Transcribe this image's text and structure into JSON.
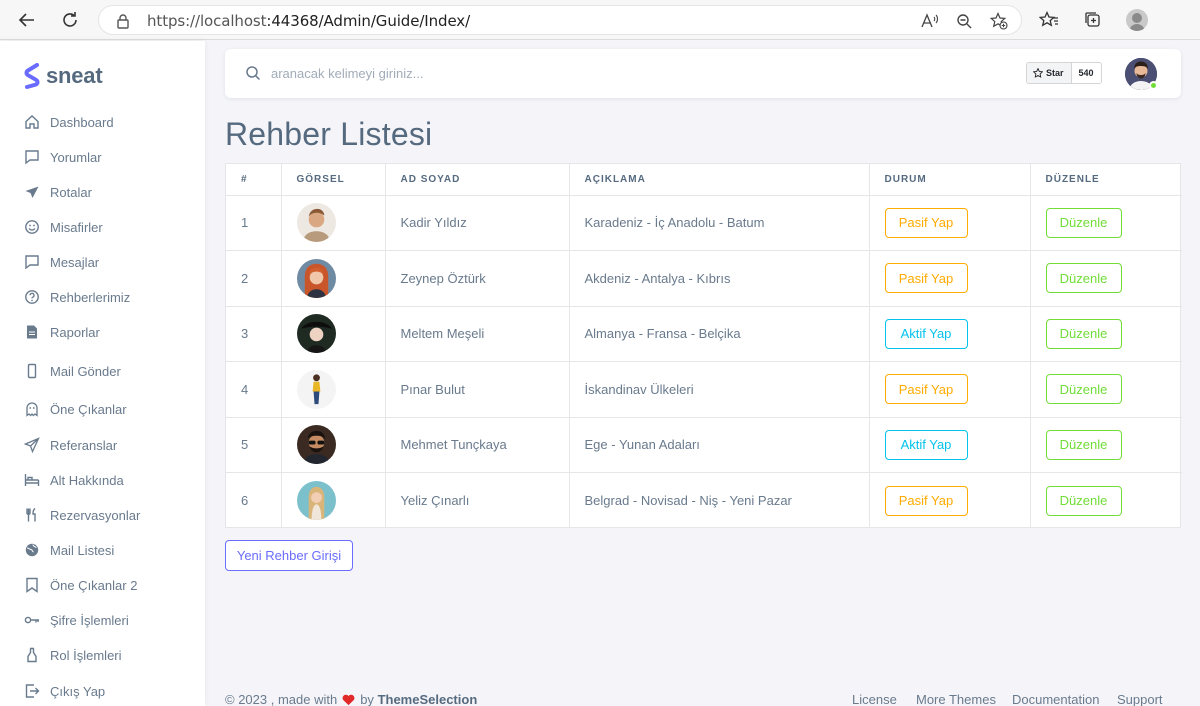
{
  "browser": {
    "url_host": "https://localhost",
    "url_rest": ":44368/Admin/Guide/Index/"
  },
  "brand": {
    "name": "sneat",
    "color": "#696cff"
  },
  "sidebar": {
    "items": [
      {
        "label": "Dashboard",
        "icon": "home-icon"
      },
      {
        "label": "Yorumlar",
        "icon": "comment-icon"
      },
      {
        "label": "Rotalar",
        "icon": "plane-icon"
      },
      {
        "label": "Misafirler",
        "icon": "smile-icon"
      },
      {
        "label": "Mesajlar",
        "icon": "message-icon"
      },
      {
        "label": "Rehberlerimiz",
        "icon": "help-circle-icon"
      },
      {
        "label": "Raporlar",
        "icon": "file-icon"
      },
      {
        "label": "Mail Gönder",
        "icon": "mobile-icon"
      },
      {
        "label": "Öne Çıkanlar",
        "icon": "ghost-icon"
      },
      {
        "label": "Referanslar",
        "icon": "send-icon"
      },
      {
        "label": "Alt Hakkında",
        "icon": "bed-icon"
      },
      {
        "label": "Rezervasyonlar",
        "icon": "restaurant-icon"
      },
      {
        "label": "Mail Listesi",
        "icon": "globe-icon"
      },
      {
        "label": "Öne Çıkanlar 2",
        "icon": "bookmark-icon"
      },
      {
        "label": "Şifre İşlemleri",
        "icon": "key-icon"
      },
      {
        "label": "Rol İşlemleri",
        "icon": "bottle-icon"
      },
      {
        "label": "Çıkış Yap",
        "icon": "logout-icon"
      }
    ]
  },
  "search": {
    "placeholder": "aranacak kelimeyi giriniz..."
  },
  "github": {
    "star_label": "Star",
    "star_count": "540"
  },
  "page": {
    "title": "Rehber Listesi"
  },
  "table": {
    "headers": [
      "#",
      "GÖRSEL",
      "AD SOYAD",
      "AÇIKLAMA",
      "DURUM",
      "DÜZENLE"
    ],
    "rows": [
      {
        "no": "1",
        "name": "Kadir Yıldız",
        "desc": "Karadeniz - İç Anadolu - Batum",
        "status": "Pasif Yap",
        "status_type": "warning",
        "edit": "Düzenle"
      },
      {
        "no": "2",
        "name": "Zeynep Öztürk",
        "desc": "Akdeniz - Antalya - Kıbrıs",
        "status": "Pasif Yap",
        "status_type": "warning",
        "edit": "Düzenle"
      },
      {
        "no": "3",
        "name": "Meltem Meşeli",
        "desc": "Almanya - Fransa - Belçika",
        "status": "Aktif Yap",
        "status_type": "info",
        "edit": "Düzenle"
      },
      {
        "no": "4",
        "name": "Pınar Bulut",
        "desc": "İskandinav Ülkeleri",
        "status": "Pasif Yap",
        "status_type": "warning",
        "edit": "Düzenle"
      },
      {
        "no": "5",
        "name": "Mehmet Tunçkaya",
        "desc": "Ege - Yunan Adaları",
        "status": "Aktif Yap",
        "status_type": "info",
        "edit": "Düzenle"
      },
      {
        "no": "6",
        "name": "Yeliz Çınarlı",
        "desc": "Belgrad - Novisad - Niş - Yeni Pazar",
        "status": "Pasif Yap",
        "status_type": "warning",
        "edit": "Düzenle"
      }
    ]
  },
  "new_button": "Yeni Rehber Girişi",
  "footer": {
    "copyright": "© 2023 , made with",
    "by": "by",
    "author": "ThemeSelection",
    "links": [
      "License",
      "More Themes",
      "Documentation",
      "Support"
    ]
  },
  "colors": {
    "warning": "#ffab00",
    "info": "#03c3ec",
    "success": "#71dd37",
    "primary": "#696cff",
    "text": "#697a8d",
    "heading": "#566a7f"
  }
}
